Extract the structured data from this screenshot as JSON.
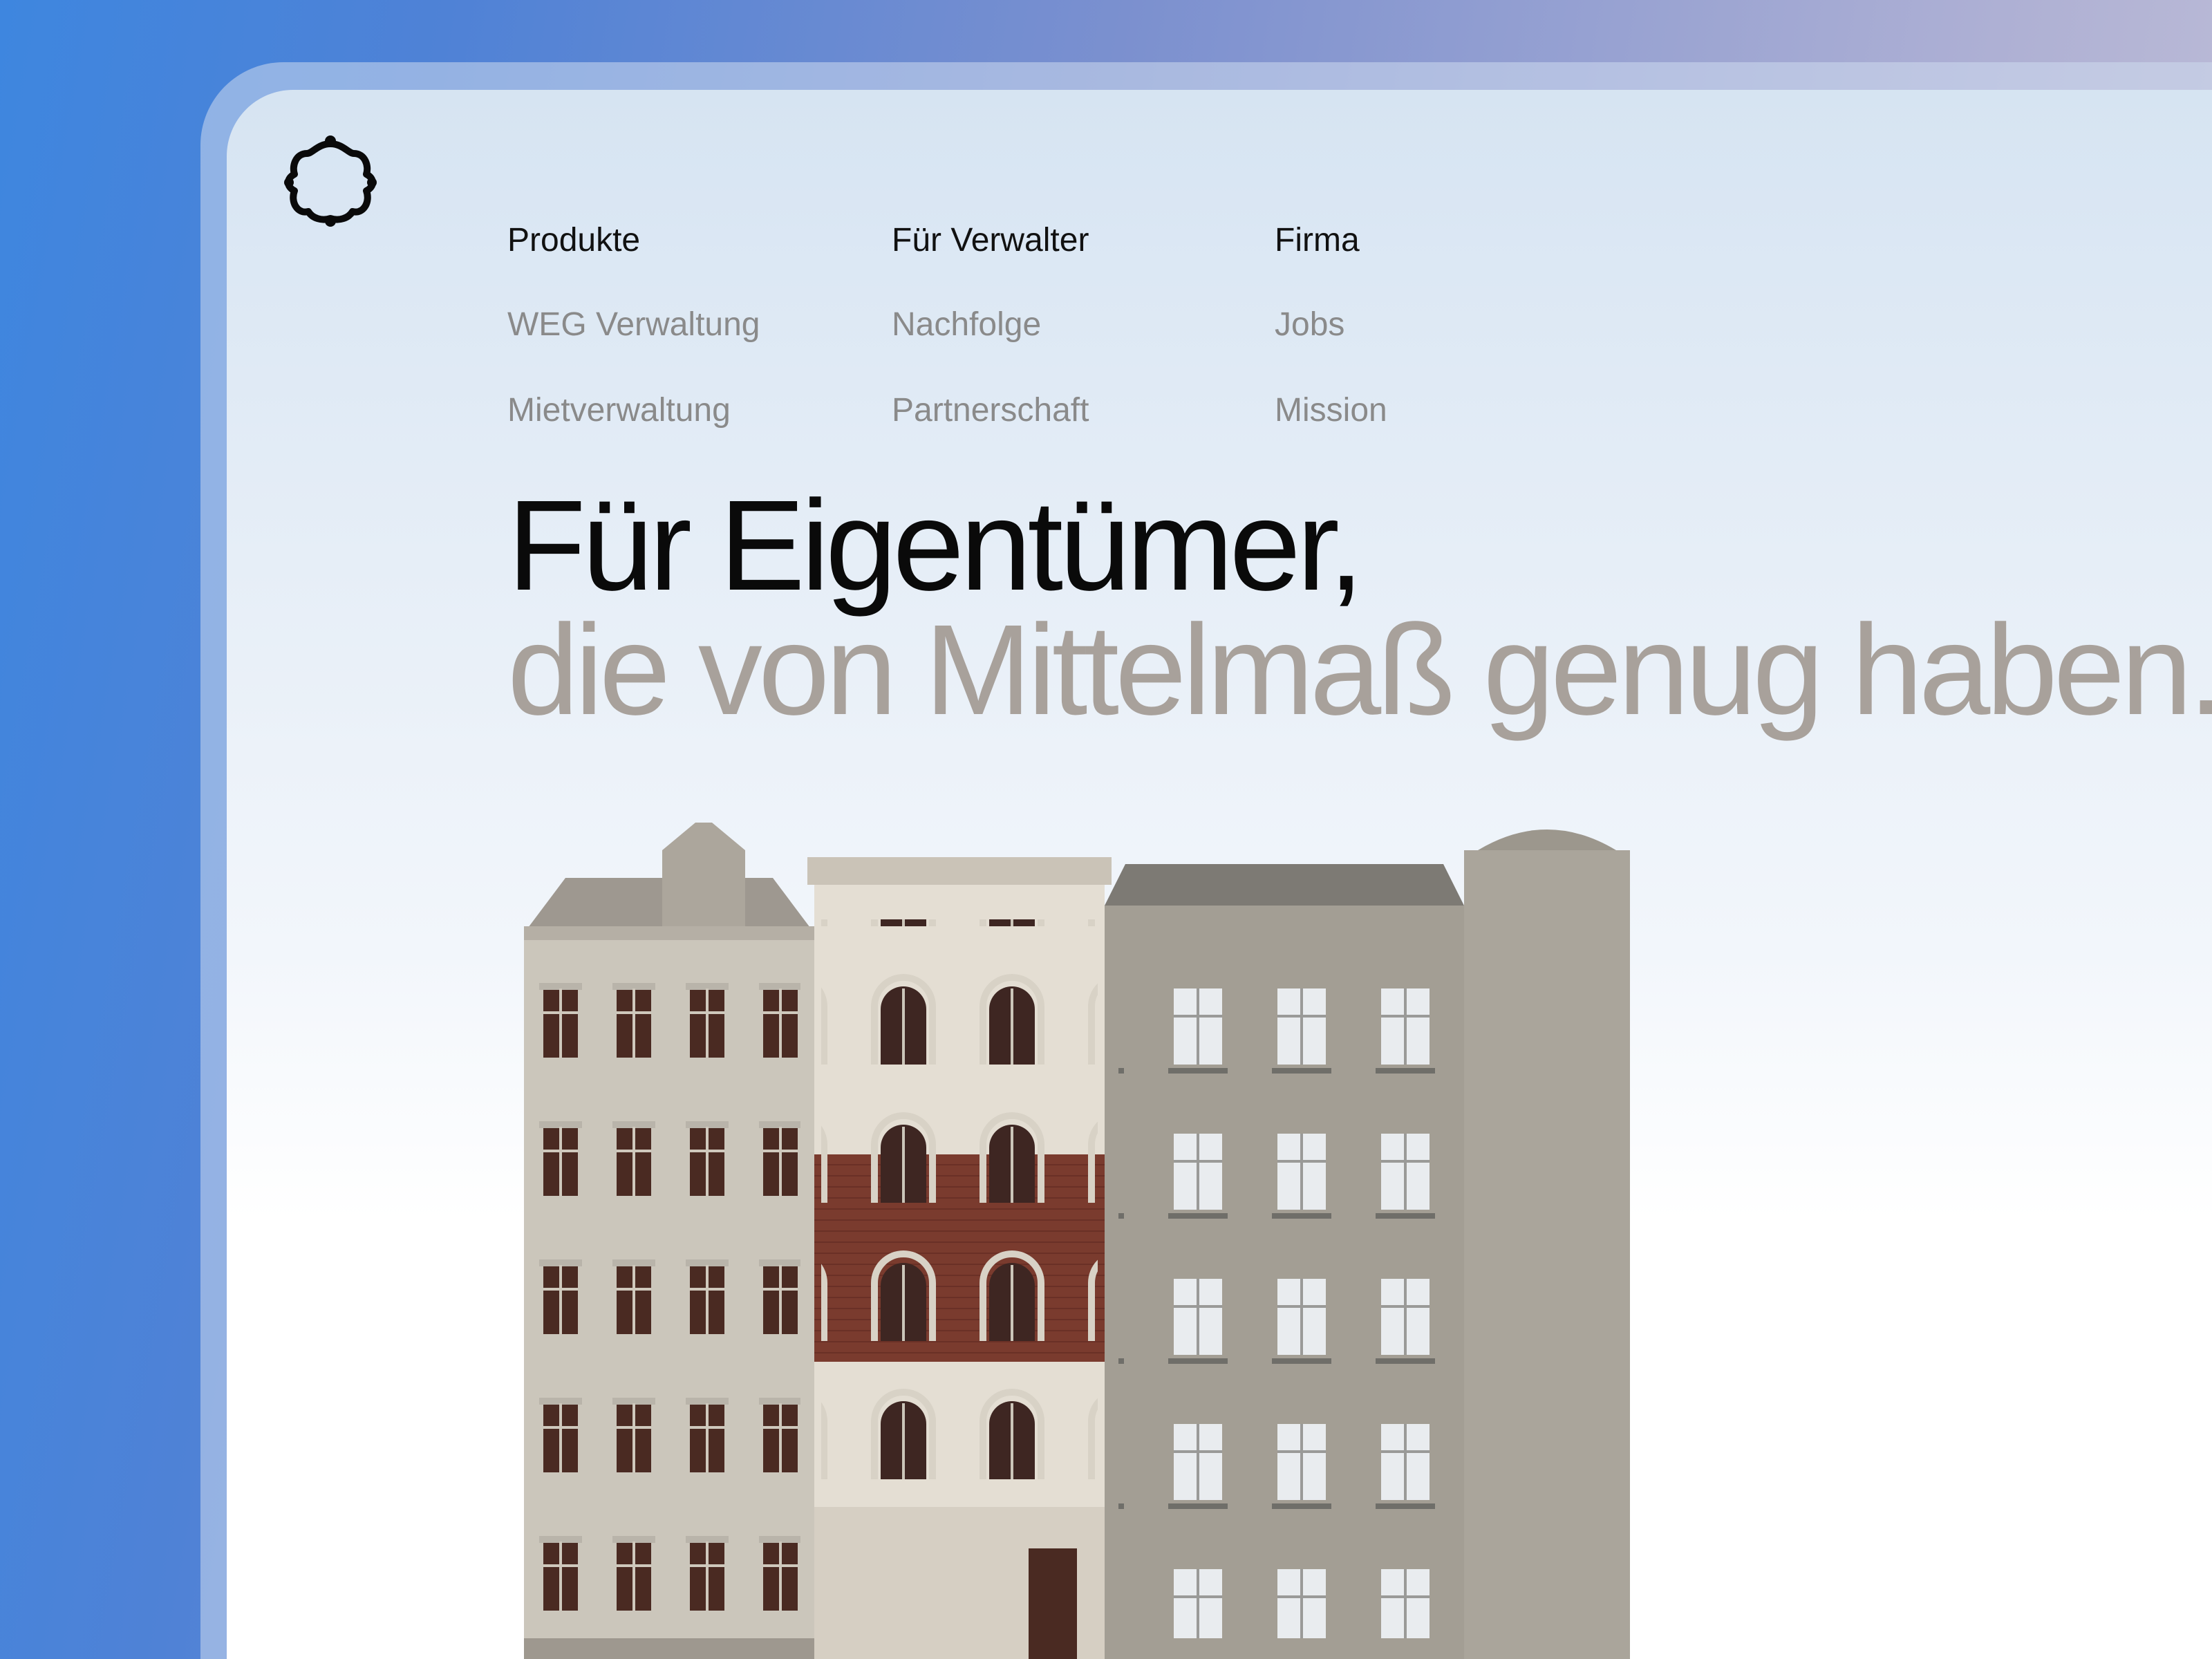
{
  "nav": {
    "columns": [
      {
        "heading": "Produkte",
        "items": [
          "WEG Verwaltung",
          "Mietverwaltung"
        ]
      },
      {
        "heading": "Für Verwalter",
        "items": [
          "Nachfolge",
          "Partnerschaft"
        ]
      },
      {
        "heading": "Firma",
        "items": [
          "Jobs",
          "Mission"
        ]
      }
    ]
  },
  "hero": {
    "line1": "Für Eigentümer,",
    "line2": "die von Mittelmaß genug haben."
  },
  "colors": {
    "headline_primary": "#0a0a0a",
    "headline_secondary": "#a8a19b",
    "nav_heading": "#111111",
    "nav_item": "#8a8a8a"
  },
  "icons": {
    "logo": "clover-outline-logo"
  },
  "image": {
    "subject": "row-of-historic-apartment-facades"
  }
}
